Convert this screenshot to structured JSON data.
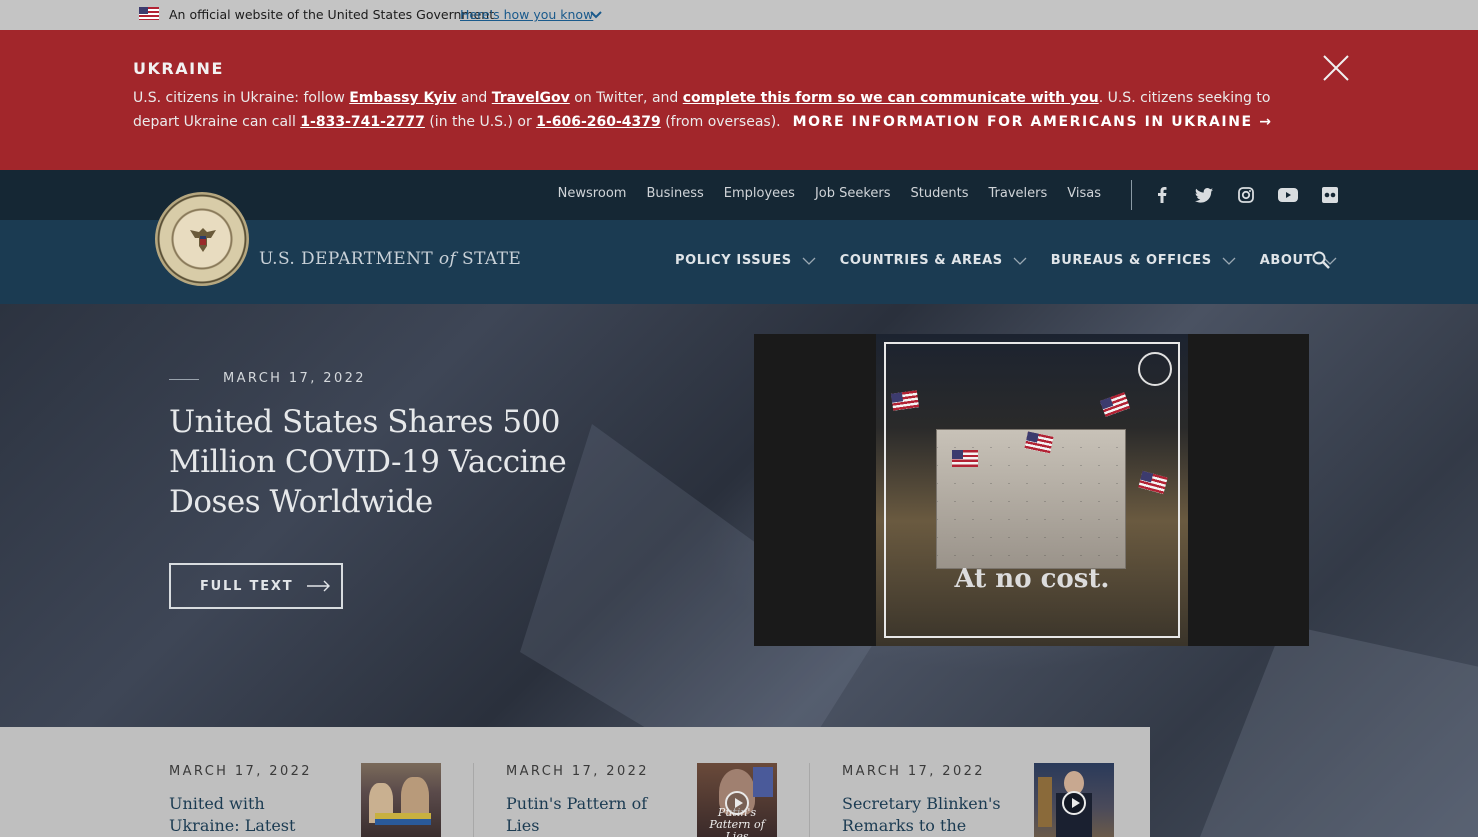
{
  "gov_banner": {
    "text": "An official website of the United States Government",
    "link": "Here's how you know",
    "flag_icon": "us-flag-icon",
    "chevron_icon": "chevron-down-icon"
  },
  "alert": {
    "title": "UKRAINE",
    "text_1": "U.S. citizens in Ukraine: follow ",
    "link_embassy": "Embassy Kyiv",
    "text_2": " and ",
    "link_travelgov": "TravelGov",
    "text_3": " on Twitter, and ",
    "link_form": "complete this form so we can communicate with you",
    "text_4": ". U.S. citizens seeking to depart Ukraine can call ",
    "phone_us": "1-833-741-2777",
    "text_5": " (in the U.S.) or ",
    "phone_overseas": "1-606-260-4379",
    "text_6": " (from overseas).",
    "more_link": "MORE INFORMATION FOR AMERICANS IN UKRAINE →",
    "close_icon": "close-icon",
    "background": "#a2262b"
  },
  "utility_nav": {
    "links": [
      "Newsroom",
      "Business",
      "Employees",
      "Job Seekers",
      "Students",
      "Travelers",
      "Visas"
    ],
    "social_icons": [
      "facebook-icon",
      "twitter-icon",
      "instagram-icon",
      "youtube-icon",
      "flickr-icon"
    ]
  },
  "header": {
    "brand_prefix": "U.S. DEPARTMENT",
    "brand_of": "of",
    "brand_suffix": "STATE",
    "nav": [
      "POLICY ISSUES",
      "COUNTRIES & AREAS",
      "BUREAUS & OFFICES",
      "ABOUT"
    ],
    "search_icon": "search-icon",
    "background": "#1b3b52"
  },
  "hero": {
    "date": "MARCH 17, 2022",
    "title": "United States Shares 500 Million COVID-19 Vaccine Doses Worldwide",
    "button": "FULL TEXT",
    "video_caption": "At no cost."
  },
  "news": [
    {
      "date": "MARCH 17, 2022",
      "title": "United with Ukraine: Latest Updates",
      "has_video": false
    },
    {
      "date": "MARCH 17, 2022",
      "title": "Putin's Pattern of Lies",
      "has_video": true,
      "thumb_text": "Putin's Pattern of Lies"
    },
    {
      "date": "MARCH 17, 2022",
      "title": "Secretary Blinken's Remarks to the Press",
      "has_video": true
    }
  ]
}
